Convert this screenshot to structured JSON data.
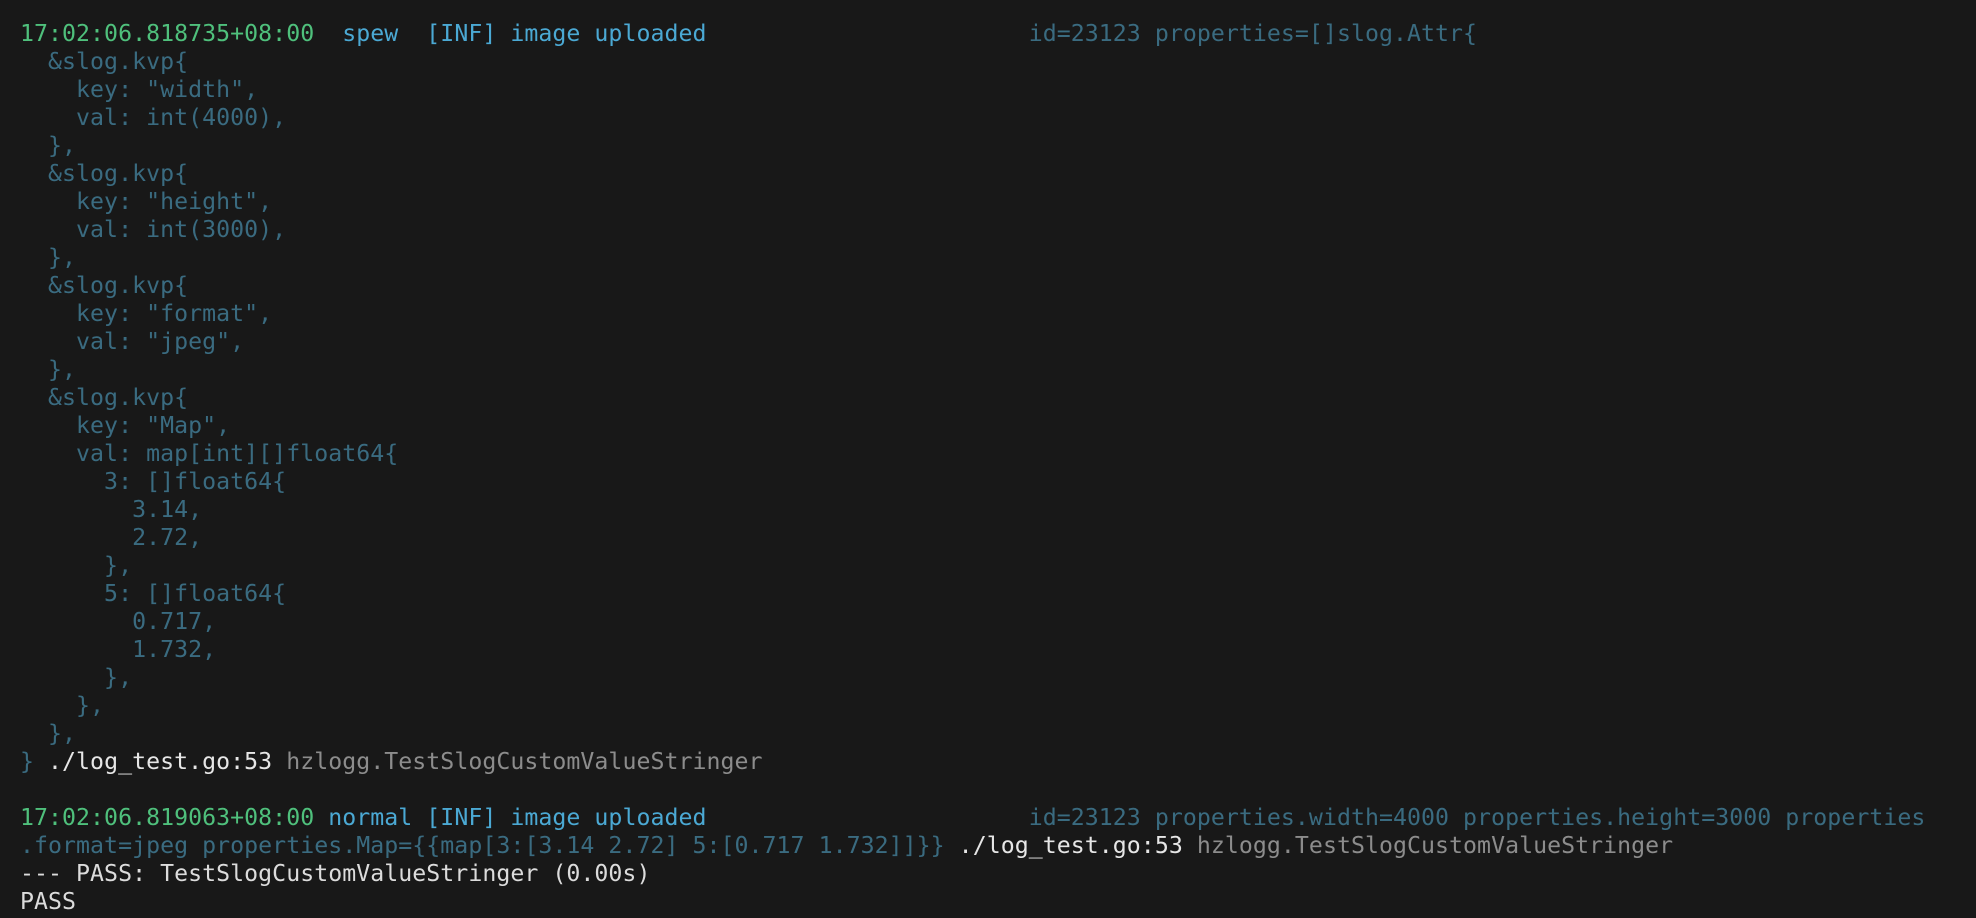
{
  "terminal": {
    "lines": [
      [
        {
          "t": "17:02:06.818735+08:00",
          "c": "ts"
        },
        {
          "t": "  spew  [INF] image uploaded",
          "c": "lvl"
        },
        {
          "t": "                       id=23123 properties=[]slog.Attr{",
          "c": "dim"
        }
      ],
      [
        {
          "t": "  &slog.kvp{",
          "c": "dim"
        }
      ],
      [
        {
          "t": "    key: \"width\",",
          "c": "dim"
        }
      ],
      [
        {
          "t": "    val: int(4000),",
          "c": "dim"
        }
      ],
      [
        {
          "t": "  },",
          "c": "dim"
        }
      ],
      [
        {
          "t": "  &slog.kvp{",
          "c": "dim"
        }
      ],
      [
        {
          "t": "    key: \"height\",",
          "c": "dim"
        }
      ],
      [
        {
          "t": "    val: int(3000),",
          "c": "dim"
        }
      ],
      [
        {
          "t": "  },",
          "c": "dim"
        }
      ],
      [
        {
          "t": "  &slog.kvp{",
          "c": "dim"
        }
      ],
      [
        {
          "t": "    key: \"format\",",
          "c": "dim"
        }
      ],
      [
        {
          "t": "    val: \"jpeg\",",
          "c": "dim"
        }
      ],
      [
        {
          "t": "  },",
          "c": "dim"
        }
      ],
      [
        {
          "t": "  &slog.kvp{",
          "c": "dim"
        }
      ],
      [
        {
          "t": "    key: \"Map\",",
          "c": "dim"
        }
      ],
      [
        {
          "t": "    val: map[int][]float64{",
          "c": "dim"
        }
      ],
      [
        {
          "t": "      3: []float64{",
          "c": "dim"
        }
      ],
      [
        {
          "t": "        3.14,",
          "c": "dim"
        }
      ],
      [
        {
          "t": "        2.72,",
          "c": "dim"
        }
      ],
      [
        {
          "t": "      },",
          "c": "dim"
        }
      ],
      [
        {
          "t": "      5: []float64{",
          "c": "dim"
        }
      ],
      [
        {
          "t": "        0.717,",
          "c": "dim"
        }
      ],
      [
        {
          "t": "        1.732,",
          "c": "dim"
        }
      ],
      [
        {
          "t": "      },",
          "c": "dim"
        }
      ],
      [
        {
          "t": "    },",
          "c": "dim"
        }
      ],
      [
        {
          "t": "  },",
          "c": "dim"
        }
      ],
      [
        {
          "t": "}",
          "c": "dim"
        },
        {
          "t": " ./log_test.go:53",
          "c": "src"
        },
        {
          "t": " hzlogg.TestSlogCustomValueStringer",
          "c": "fn"
        }
      ],
      [],
      [
        {
          "t": "17:02:06.819063+08:00",
          "c": "ts"
        },
        {
          "t": " normal [INF] image uploaded",
          "c": "lvl"
        },
        {
          "t": "                       id=23123 properties.width=4000 properties.height=3000 properties",
          "c": "dim"
        }
      ],
      [
        {
          "t": ".format=jpeg properties.Map={{map[3:[3.14 2.72] 5:[0.717 1.732]]}}",
          "c": "dim"
        },
        {
          "t": " ./log_test.go:53",
          "c": "src"
        },
        {
          "t": " hzlogg.TestSlogCustomValueStringer",
          "c": "fn"
        }
      ],
      [
        {
          "t": "--- PASS: TestSlogCustomValueStringer (0.00s)",
          "c": "out"
        }
      ],
      [
        {
          "t": "PASS",
          "c": "out"
        }
      ]
    ]
  }
}
